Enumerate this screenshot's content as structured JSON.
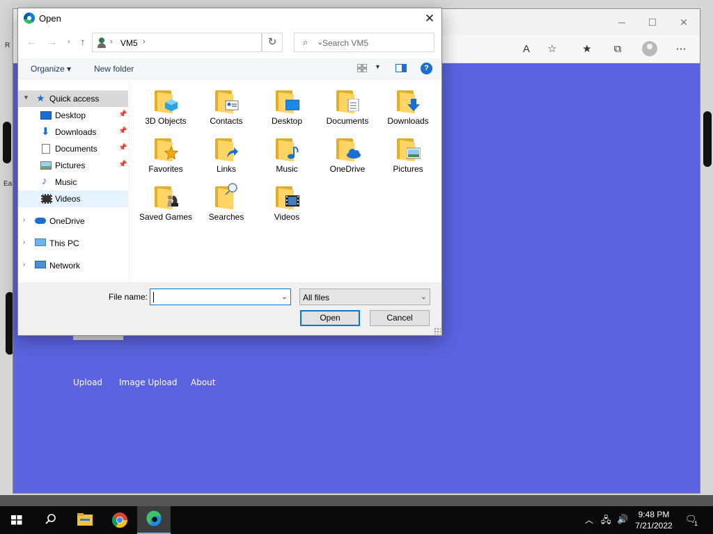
{
  "dialog": {
    "title": "Open",
    "address": {
      "location": "VM5"
    },
    "search_placeholder": "Search VM5",
    "commands": {
      "organize": "Organize",
      "new_folder": "New folder"
    },
    "nav_pane": {
      "quick_access": "Quick access",
      "pinned": [
        "Desktop",
        "Downloads",
        "Documents",
        "Pictures"
      ],
      "recent": [
        "Music",
        "Videos"
      ],
      "roots": [
        "OneDrive",
        "This PC",
        "Network"
      ]
    },
    "files": [
      {
        "name": "3D Objects",
        "icon": "3d-objects-folder-icon"
      },
      {
        "name": "Contacts",
        "icon": "contacts-folder-icon"
      },
      {
        "name": "Desktop",
        "icon": "desktop-folder-icon"
      },
      {
        "name": "Documents",
        "icon": "documents-folder-icon"
      },
      {
        "name": "Downloads",
        "icon": "downloads-folder-icon"
      },
      {
        "name": "Favorites",
        "icon": "favorites-folder-icon"
      },
      {
        "name": "Links",
        "icon": "links-folder-icon"
      },
      {
        "name": "Music",
        "icon": "music-folder-icon"
      },
      {
        "name": "OneDrive",
        "icon": "onedrive-folder-icon"
      },
      {
        "name": "Pictures",
        "icon": "pictures-folder-icon"
      },
      {
        "name": "Saved Games",
        "icon": "saved-games-folder-icon"
      },
      {
        "name": "Searches",
        "icon": "searches-folder-icon"
      },
      {
        "name": "Videos",
        "icon": "videos-folder-icon"
      }
    ],
    "file_name_label": "File name:",
    "file_name_value": "",
    "file_type": "All files",
    "open_button": "Open",
    "cancel_button": "Cancel"
  },
  "page": {
    "nav": [
      "Upload",
      "Image Upload",
      "About"
    ]
  },
  "wallpaper": {
    "edge_text": [
      "R",
      "Ea"
    ]
  },
  "taskbar": {
    "time": "9:48 PM",
    "date": "7/21/2022",
    "notification_count": "1"
  },
  "colors": {
    "page_background": "#5b63e0",
    "accent": "#0078d7",
    "folder": "#ffd665"
  }
}
